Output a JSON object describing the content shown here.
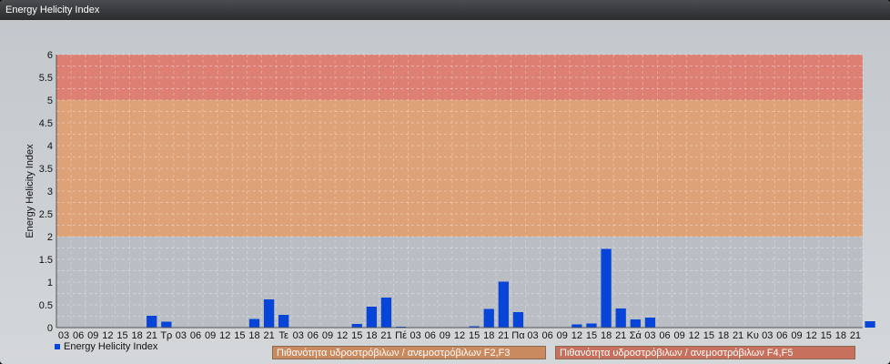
{
  "window": {
    "title": "Energy Helicity Index"
  },
  "chart_data": {
    "type": "bar",
    "title": "",
    "xlabel": "",
    "ylabel": "Energy Helicity Index",
    "ylim": [
      0,
      6
    ],
    "yticks": [
      "0",
      "0.5",
      "1",
      "1.5",
      "2",
      "2.5",
      "3",
      "3.5",
      "4",
      "4.5",
      "5",
      "5.5",
      "6"
    ],
    "grid": true,
    "categories": [
      "03",
      "06",
      "09",
      "12",
      "15",
      "18",
      "21",
      "Τρ",
      "03",
      "06",
      "09",
      "12",
      "15",
      "18",
      "21",
      "Τε",
      "03",
      "06",
      "09",
      "12",
      "15",
      "18",
      "21",
      "Πέ",
      "03",
      "06",
      "09",
      "12",
      "15",
      "18",
      "21",
      "Πα",
      "03",
      "06",
      "09",
      "12",
      "15",
      "18",
      "21",
      "Σά",
      "03",
      "06",
      "09",
      "12",
      "15",
      "18",
      "21",
      "Κυ",
      "03",
      "06",
      "09",
      "12",
      "15",
      "18",
      "21"
    ],
    "series": [
      {
        "name": "Energy Helicity Index",
        "color": "#0645d8",
        "values": [
          0.01,
          0.01,
          0.01,
          0.01,
          0.01,
          0.01,
          0.26,
          0.13,
          0.01,
          0.01,
          0.01,
          0.01,
          0.01,
          0.19,
          0.62,
          0.28,
          0.01,
          0.01,
          0.01,
          0.01,
          0.08,
          0.46,
          0.66,
          0.02,
          0.01,
          0.01,
          0.01,
          0.01,
          0.03,
          0.41,
          1.01,
          0.34,
          0.01,
          0.01,
          0.01,
          0.07,
          0.09,
          1.73,
          0.42,
          0.18,
          0.22,
          0.01,
          0.01,
          0.01,
          0.01,
          0.01,
          0.01,
          0.01,
          0.01,
          0.01,
          0.01,
          0.01,
          0.01,
          0.01,
          0.01,
          0.14
        ]
      }
    ],
    "bands": [
      {
        "from": 2,
        "to": 5,
        "color": "#e0a070",
        "label": "Πιθανότητα υδροστρόβιλων / ανεμοστρόβιλων F2,F3"
      },
      {
        "from": 5,
        "to": 6,
        "color": "#e07a6a",
        "label": "Πιθανότητα υδροστρόβιλων / ανεμοστρόβιλων F4,F5"
      }
    ],
    "legend_position": "bottom-left"
  }
}
